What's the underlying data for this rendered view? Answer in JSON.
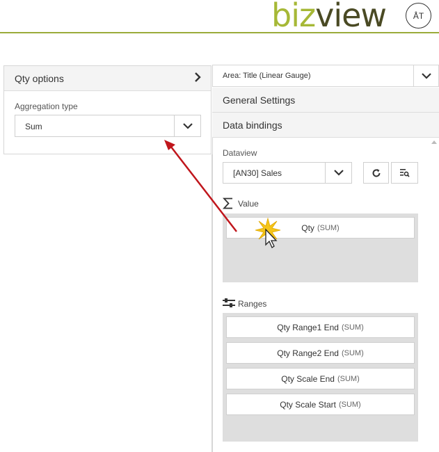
{
  "header": {
    "logo_biz": "biz",
    "logo_view": "view",
    "user_initials": "ÅT"
  },
  "left_panel": {
    "title": "Qty options",
    "aggregation_label": "Aggregation type",
    "aggregation_value": "Sum"
  },
  "right_panel": {
    "area_select": "Area: Title (Linear Gauge)",
    "sections": [
      "General Settings",
      "Data bindings"
    ],
    "dataview_label": "Dataview",
    "dataview_value": "[AN30] Sales",
    "value_label": "Value",
    "value_fields": [
      {
        "name": "Qty",
        "agg": "(SUM)"
      }
    ],
    "ranges_label": "Ranges",
    "range_fields": [
      {
        "name": "Qty Range1 End",
        "agg": "(SUM)"
      },
      {
        "name": "Qty Range2 End",
        "agg": "(SUM)"
      },
      {
        "name": "Qty Scale End",
        "agg": "(SUM)"
      },
      {
        "name": "Qty Scale Start",
        "agg": "(SUM)"
      }
    ]
  },
  "colors": {
    "logo_green": "#a6b836",
    "logo_dark": "#4a4a24",
    "annotation_arrow": "#c0161c",
    "click_burst": "#f5c518"
  },
  "icons": [
    "chevron-right-icon",
    "chevron-down-icon",
    "refresh-icon",
    "inspect-icon",
    "sigma-icon",
    "sliders-icon",
    "cursor-icon"
  ]
}
